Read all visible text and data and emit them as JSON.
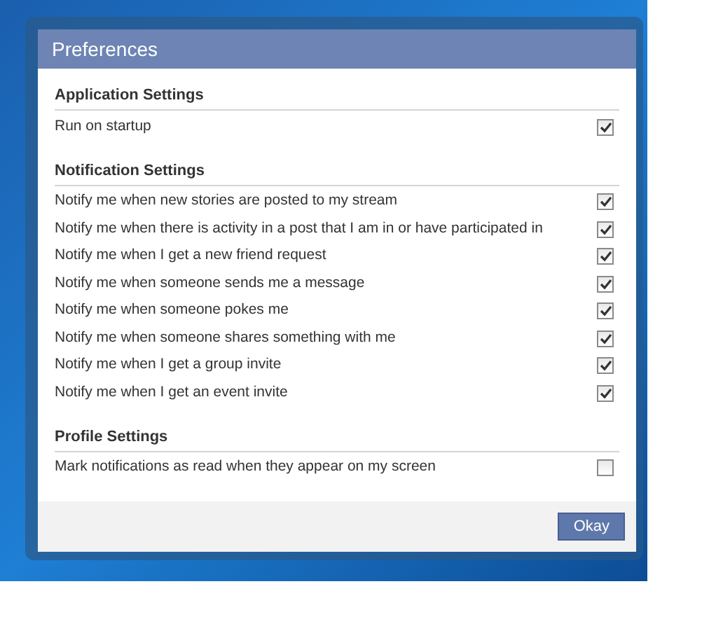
{
  "dialog": {
    "title": "Preferences"
  },
  "sections": [
    {
      "heading": "Application Settings",
      "options": [
        {
          "label": "Run on startup",
          "checked": true
        }
      ]
    },
    {
      "heading": "Notification Settings",
      "options": [
        {
          "label": "Notify me when new stories are posted to my stream",
          "checked": true
        },
        {
          "label": "Notify me when there is activity in a post that I am in or have participated in",
          "checked": true
        },
        {
          "label": "Notify me when I get a new friend request",
          "checked": true
        },
        {
          "label": "Notify me when someone sends me a message",
          "checked": true
        },
        {
          "label": "Notify me when someone pokes me",
          "checked": true
        },
        {
          "label": "Notify me when someone shares something with me",
          "checked": true
        },
        {
          "label": "Notify me when I get a group invite",
          "checked": true
        },
        {
          "label": "Notify me when I get an event invite",
          "checked": true
        }
      ]
    },
    {
      "heading": "Profile Settings",
      "options": [
        {
          "label": "Mark notifications as read when they appear on my screen",
          "checked": false
        }
      ]
    }
  ],
  "buttons": [
    "Okay"
  ]
}
